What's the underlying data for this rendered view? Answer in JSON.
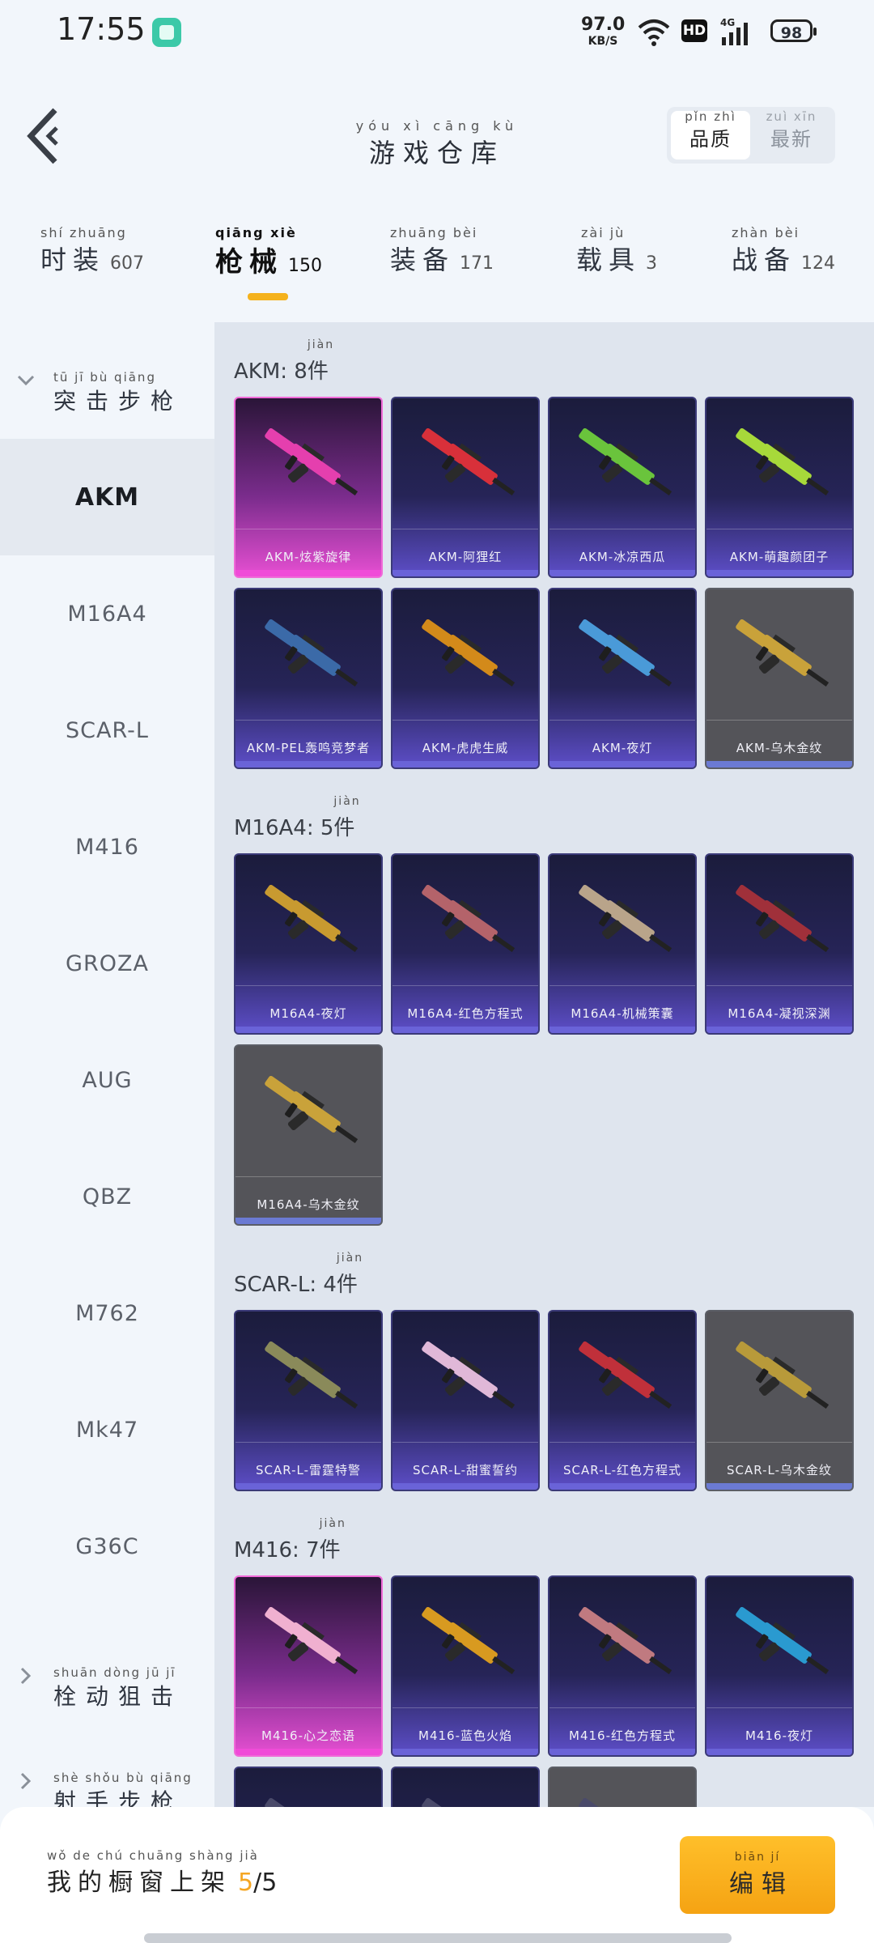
{
  "status_bar": {
    "time": "17:55",
    "net_speed": "97.0",
    "net_unit": "KB/S",
    "hd": "HD",
    "signal": "4G",
    "battery": "98"
  },
  "header": {
    "title_pinyin": "yóu xì cāng kù",
    "title": "游戏仓库",
    "sort": [
      {
        "pinyin": "pǐn zhì",
        "label": "品质",
        "active": true
      },
      {
        "pinyin": "zuì xīn",
        "label": "最新",
        "active": false
      }
    ]
  },
  "categories": [
    {
      "pinyin": "shí zhuāng",
      "label": "时装",
      "count": "607"
    },
    {
      "pinyin": "qiāng xiè",
      "label": "枪械",
      "count": "150",
      "active": true
    },
    {
      "pinyin": "zhuāng bèi",
      "label": "装备",
      "count": "171"
    },
    {
      "pinyin": "zài jù",
      "label": "载具",
      "count": "3"
    },
    {
      "pinyin": "zhàn bèi",
      "label": "战备",
      "count": "124"
    }
  ],
  "sidebar": {
    "group_assault": {
      "pinyin": "tū jī bù qiāng",
      "label": "突击步枪"
    },
    "items": [
      "AKM",
      "M16A4",
      "SCAR-L",
      "M416",
      "GROZA",
      "AUG",
      "QBZ",
      "M762",
      "Mk47",
      "G36C"
    ],
    "group_bolt": {
      "pinyin": "shuān dòng jū jī",
      "label": "栓动狙击"
    },
    "group_dmr": {
      "pinyin": "shè shǒu bù qiāng",
      "label": "射手步枪"
    }
  },
  "sections": [
    {
      "title": "AKM: 8",
      "unit": "件",
      "unit_pinyin": "jiàn",
      "cards": [
        {
          "label": "AKM-炫紫旋律",
          "tier": "pink",
          "gun": "#e53fae"
        },
        {
          "label": "AKM-阿狸红",
          "tier": "purple",
          "gun": "#d8303a"
        },
        {
          "label": "AKM-冰凉西瓜",
          "tier": "purple",
          "gun": "#6ac43c"
        },
        {
          "label": "AKM-萌趣颜团子",
          "tier": "purple",
          "gun": "#a7d93a"
        },
        {
          "label": "AKM-PEL轰鸣竞梦者",
          "tier": "purple",
          "gun": "#3b6aa8"
        },
        {
          "label": "AKM-虎虎生威",
          "tier": "purple",
          "gun": "#d38a1a"
        },
        {
          "label": "AKM-夜灯",
          "tier": "purple",
          "gun": "#4a9ad8"
        },
        {
          "label": "AKM-乌木金纹",
          "tier": "gray",
          "gun": "#c9a23a"
        }
      ]
    },
    {
      "title": "M16A4: 5",
      "unit": "件",
      "unit_pinyin": "jiàn",
      "cards": [
        {
          "label": "M16A4-夜灯",
          "tier": "purple",
          "gun": "#c89a30"
        },
        {
          "label": "M16A4-红色方程式",
          "tier": "purple",
          "gun": "#b4636a"
        },
        {
          "label": "M16A4-机械策囊",
          "tier": "purple",
          "gun": "#b9a48a"
        },
        {
          "label": "M16A4-凝视深渊",
          "tier": "purple",
          "gun": "#a0303a"
        },
        {
          "label": "M16A4-乌木金纹",
          "tier": "gray",
          "gun": "#c9a23a"
        }
      ]
    },
    {
      "title": "SCAR-L: 4",
      "unit": "件",
      "unit_pinyin": "jiàn",
      "cards": [
        {
          "label": "SCAR-L-雷霆特警",
          "tier": "purple",
          "gun": "#8a8a5a"
        },
        {
          "label": "SCAR-L-甜蜜誓约",
          "tier": "purple",
          "gun": "#e0b8d8"
        },
        {
          "label": "SCAR-L-红色方程式",
          "tier": "purple",
          "gun": "#c0303a"
        },
        {
          "label": "SCAR-L-乌木金纹",
          "tier": "gray",
          "gun": "#b89a3a"
        }
      ]
    },
    {
      "title": "M416: 7",
      "unit": "件",
      "unit_pinyin": "jiàn",
      "cards": [
        {
          "label": "M416-心之恋语",
          "tier": "pink",
          "gun": "#f0b0d0"
        },
        {
          "label": "M416-蓝色火焰",
          "tier": "purple",
          "gun": "#d89a20"
        },
        {
          "label": "M416-红色方程式",
          "tier": "purple",
          "gun": "#c07a80"
        },
        {
          "label": "M416-夜灯",
          "tier": "purple",
          "gun": "#2a9ad0"
        },
        {
          "label": "",
          "tier": "purple",
          "gun": "#4a4a6a"
        },
        {
          "label": "",
          "tier": "purple",
          "gun": "#4a4a6a"
        },
        {
          "label": "",
          "tier": "gray",
          "gun": "#4a4a6a"
        }
      ]
    }
  ],
  "bottom": {
    "shelf_pinyin": "wǒ de chú chuāng shàng jià",
    "shelf_label": "我的橱窗上架",
    "shelf_current": "5",
    "shelf_total": "/5",
    "edit_pinyin": "biān jí",
    "edit_label": "编辑"
  },
  "colors": {
    "accent": "#f5b21d",
    "pink_tier": "#e64fd2",
    "purple_tier": "#5d4ec8",
    "gray_tier": "#545459"
  }
}
